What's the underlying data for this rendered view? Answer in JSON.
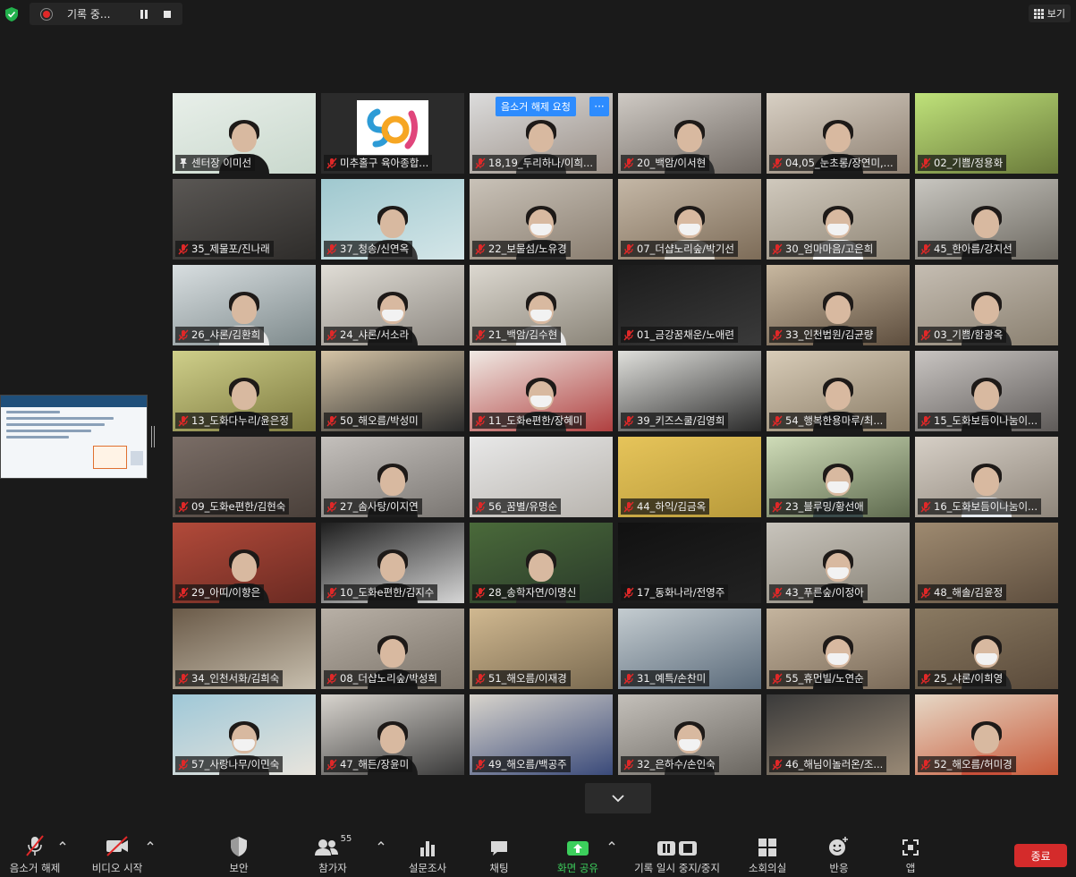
{
  "recording": {
    "label": "기록 중..."
  },
  "view": {
    "label": "보기"
  },
  "unmute_request": {
    "label": "음소거 해제 요청",
    "more": "···"
  },
  "participants": [
    {
      "name": "센터장 이미선",
      "bg": [
        "#e8efe9",
        "#c9d8cd"
      ],
      "shirt": "#1a1a1a",
      "mask": false,
      "person": true
    },
    {
      "name": "미추홀구 육아종합...",
      "bg": [
        "#2b2b2b",
        "#2b2b2b"
      ],
      "logo": true,
      "person": false
    },
    {
      "name": "18,19_두리하나/이희...",
      "bg": [
        "#dcdcdc",
        "#9a8f86"
      ],
      "shirt": "#3a3a3a",
      "mask": false,
      "person": true
    },
    {
      "name": "20_백암/이서현",
      "bg": [
        "#cfcac4",
        "#6f6862"
      ],
      "shirt": "#2e2e2e",
      "mask": false,
      "person": true
    },
    {
      "name": "04,05_눈초롱/장연미,...",
      "bg": [
        "#d8d0c4",
        "#8e8072"
      ],
      "shirt": "#1c1c1c",
      "mask": false,
      "person": true
    },
    {
      "name": "02_기쁨/정용화",
      "bg": [
        "#bfe27a",
        "#6a7a3a"
      ],
      "person": false
    },
    {
      "name": "35_제물포/진나래",
      "bg": [
        "#5a5754",
        "#2e2c2a"
      ],
      "person": false
    },
    {
      "name": "37_청송/신연옥",
      "bg": [
        "#9fc8cf",
        "#d4e6e8"
      ],
      "shirt": "#3b3b3b",
      "mask": false,
      "person": true
    },
    {
      "name": "22_보물섬/노유경",
      "bg": [
        "#c9c2b8",
        "#8a7e70"
      ],
      "shirt": "#2a2a2a",
      "mask": true,
      "person": true
    },
    {
      "name": "07_더샵노리숲/박기선",
      "bg": [
        "#c4b7a6",
        "#7d6c58"
      ],
      "shirt": "#d8d2c8",
      "mask": true,
      "person": true
    },
    {
      "name": "30_엄마마음/고은희",
      "bg": [
        "#d0c9bd",
        "#8f8575"
      ],
      "shirt": "#fafafa",
      "mask": true,
      "person": true
    },
    {
      "name": "45_한아름/강지선",
      "bg": [
        "#c8c6c0",
        "#6e6a62"
      ],
      "shirt": "#1e1e1e",
      "mask": false,
      "person": true
    },
    {
      "name": "26_샤론/김환희",
      "bg": [
        "#d8dee0",
        "#7e8a8c"
      ],
      "shirt": "#e8e8e8",
      "mask": false,
      "person": true
    },
    {
      "name": "24_샤론/서소라",
      "bg": [
        "#e0ddd6",
        "#8c8780"
      ],
      "shirt": "#1e1e1e",
      "mask": true,
      "person": true
    },
    {
      "name": "21_백암/김수현",
      "bg": [
        "#dcd8d0",
        "#8a8478"
      ],
      "shirt": "#e6e6e6",
      "mask": true,
      "person": true
    },
    {
      "name": "01_금강꿈채운/노애련",
      "bg": [
        "#1c1c1c",
        "#3a3a3a"
      ],
      "person": false
    },
    {
      "name": "33_인천법원/김균량",
      "bg": [
        "#c8b8a0",
        "#5e4e3e"
      ],
      "shirt": "#1c1c1c",
      "mask": false,
      "person": true
    },
    {
      "name": "03_기쁨/함광옥",
      "bg": [
        "#c5bdb2",
        "#8a8070"
      ],
      "shirt": "#2a2a2a",
      "mask": false,
      "person": true
    },
    {
      "name": "13_도화다누리/윤은정",
      "bg": [
        "#cfcf8a",
        "#7d7a3f"
      ],
      "shirt": "#1a1a1a",
      "mask": false,
      "person": true
    },
    {
      "name": "50_해오름/박성미",
      "bg": [
        "#d5c4a6",
        "#2b2b2b"
      ],
      "person": false
    },
    {
      "name": "11_도화e편한/장혜미",
      "bg": [
        "#f0eae4",
        "#b04040"
      ],
      "shirt": "#2a2a2a",
      "mask": true,
      "person": true
    },
    {
      "name": "39_키즈스쿨/김영희",
      "bg": [
        "#e0e0dc",
        "#2b2b2b"
      ],
      "person": false
    },
    {
      "name": "54_행복한용마루/최...",
      "bg": [
        "#d8ccb8",
        "#8a7c66"
      ],
      "shirt": "#1a1a1a",
      "mask": false,
      "person": true
    },
    {
      "name": "15_도화보듬이나눔이...",
      "bg": [
        "#c9c5c2",
        "#5e5a58"
      ],
      "shirt": "#1a1a1a",
      "mask": false,
      "person": true
    },
    {
      "name": "09_도화e편한/김현숙",
      "bg": [
        "#7a6d66",
        "#4a403a"
      ],
      "person": false
    },
    {
      "name": "27_솜사탕/이지연",
      "bg": [
        "#c4c0bc",
        "#7a7672"
      ],
      "shirt": "#1e1e1e",
      "mask": false,
      "person": true
    },
    {
      "name": "56_꿈별/유명순",
      "bg": [
        "#e8e8e8",
        "#b8b4ae"
      ],
      "person": false
    },
    {
      "name": "44_하익/김금옥",
      "bg": [
        "#e6c45a",
        "#b89a3a"
      ],
      "person": false
    },
    {
      "name": "23_블루밍/황선애",
      "bg": [
        "#cfdcb8",
        "#5e6a4e"
      ],
      "shirt": "#3a4a4a",
      "mask": true,
      "person": true
    },
    {
      "name": "16_도화보듬이나눔이...",
      "bg": [
        "#d6cfc6",
        "#8e857a"
      ],
      "shirt": "#e4e8ee",
      "mask": false,
      "person": true
    },
    {
      "name": "29_아띠/이향은",
      "bg": [
        "#b24a3a",
        "#6a2a22"
      ],
      "shirt": "#1a1a1a",
      "mask": false,
      "person": true
    },
    {
      "name": "10_도화e편한/김지수",
      "bg": [
        "#1e1e1e",
        "#d6d6d6"
      ],
      "shirt": "#1a1a1a",
      "mask": false,
      "person": true
    },
    {
      "name": "28_송학자연/이명신",
      "bg": [
        "#4a6a3a",
        "#2a3a2a"
      ],
      "shirt": "#2a2a2a",
      "mask": false,
      "person": true
    },
    {
      "name": "17_동화나라/전영주",
      "bg": [
        "#111111",
        "#222222"
      ],
      "person": false
    },
    {
      "name": "43_푸른숲/이정아",
      "bg": [
        "#c8c4bc",
        "#8a8478"
      ],
      "shirt": "#1a1a1a",
      "mask": true,
      "person": true
    },
    {
      "name": "48_해솔/김윤정",
      "bg": [
        "#9e8a70",
        "#5e4e3e"
      ],
      "person": false
    },
    {
      "name": "34_인천서화/김희숙",
      "bg": [
        "#6a5a48",
        "#c8bfae"
      ],
      "person": false
    },
    {
      "name": "08_더샵노리숲/박성희",
      "bg": [
        "#b8b0a6",
        "#7a7268"
      ],
      "shirt": "#1a1a1a",
      "mask": false,
      "person": true
    },
    {
      "name": "51_해오름/이재경",
      "bg": [
        "#d0b890",
        "#7a6a50"
      ],
      "person": false
    },
    {
      "name": "31_예특/손찬미",
      "bg": [
        "#c4ccd0",
        "#5a6a7a"
      ],
      "person": false
    },
    {
      "name": "55_휴먼빌/노연순",
      "bg": [
        "#c4b49e",
        "#7a6a58"
      ],
      "shirt": "#1a1a1a",
      "mask": true,
      "person": true
    },
    {
      "name": "25_샤론/이희영",
      "bg": [
        "#8a7a62",
        "#5a4a3a"
      ],
      "shirt": "#2a2a2a",
      "mask": true,
      "person": true
    },
    {
      "name": "57_사랑나무/이민숙",
      "bg": [
        "#9fc8d8",
        "#e8e4dc"
      ],
      "shirt": "#3a3a3a",
      "mask": true,
      "person": true
    },
    {
      "name": "47_해든/장윤미",
      "bg": [
        "#d8d4ce",
        "#3a3a3a"
      ],
      "shirt": "#1a1a1a",
      "mask": false,
      "person": true
    },
    {
      "name": "49_해오름/백공주",
      "bg": [
        "#d8d4cc",
        "#3a4a7a"
      ],
      "person": false
    },
    {
      "name": "32_은하수/손인숙",
      "bg": [
        "#c4c0ba",
        "#6a6660"
      ],
      "shirt": "#2a2a2a",
      "mask": true,
      "person": true
    },
    {
      "name": "46_해님이놀러온/조...",
      "bg": [
        "#3a3a3a",
        "#9a8a76"
      ],
      "person": false
    },
    {
      "name": "52_해오름/허미경",
      "bg": [
        "#e6d8c6",
        "#c85a3a"
      ],
      "shirt": "#c8503a",
      "mask": false,
      "person": true
    }
  ],
  "toolbar": {
    "unmute": "음소거 해제",
    "start_video": "비디오 시작",
    "security": "보안",
    "participants": "참가자",
    "participants_count": "55",
    "polls": "설문조사",
    "chat": "채팅",
    "share_screen": "화면 공유",
    "record": "기록 일시 중지/중지",
    "breakout": "소회의실",
    "reactions": "반응",
    "apps": "앱",
    "end": "종료"
  },
  "colors": {
    "accent_green": "#3ccf5c",
    "active_speaker": "#d9ec4c",
    "end_red": "#d42b2b",
    "mute_red": "#e02828"
  }
}
